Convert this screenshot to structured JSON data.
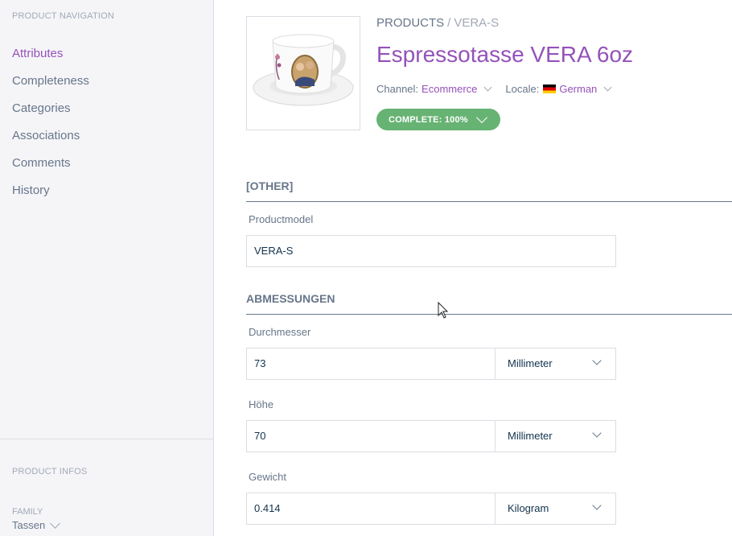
{
  "sidebar": {
    "nav_title": "PRODUCT NAVIGATION",
    "items": [
      {
        "label": "Attributes"
      },
      {
        "label": "Completeness"
      },
      {
        "label": "Categories"
      },
      {
        "label": "Associations"
      },
      {
        "label": "Comments"
      },
      {
        "label": "History"
      }
    ],
    "active_item": "Attributes",
    "infos_title": "PRODUCT INFOS",
    "family_label": "FAMILY",
    "family_value": "Tassen"
  },
  "header": {
    "breadcrumb_root": "PRODUCTS",
    "breadcrumb_separator": "/",
    "breadcrumb_current": "VERA-S",
    "title": "Espressotasse VERA 6oz",
    "channel_label": "Channel:",
    "channel_value": "Ecommerce",
    "locale_label": "Locale:",
    "locale_value": "German",
    "completeness_label": "COMPLETE: 100%",
    "completeness_percent": 100
  },
  "sections": {
    "other": {
      "title": "[OTHER]",
      "productmodel_label": "Productmodel",
      "productmodel_value": "VERA-S"
    },
    "abmessungen": {
      "title": "ABMESSUNGEN",
      "durchmesser_label": "Durchmesser",
      "durchmesser_value": "73",
      "durchmesser_unit": "Millimeter",
      "hoehe_label": "Höhe",
      "hoehe_value": "70",
      "hoehe_unit": "Millimeter",
      "gewicht_label": "Gewicht",
      "gewicht_value": "0.414",
      "gewicht_unit": "Kilogram"
    }
  },
  "colors": {
    "accent": "#9452ba",
    "success": "#67b373",
    "text": "#67768a",
    "sidebar_bg": "#f5f5f8"
  },
  "icons": [
    "chevron-down-icon",
    "flag-de-icon",
    "mouse-cursor-icon"
  ]
}
